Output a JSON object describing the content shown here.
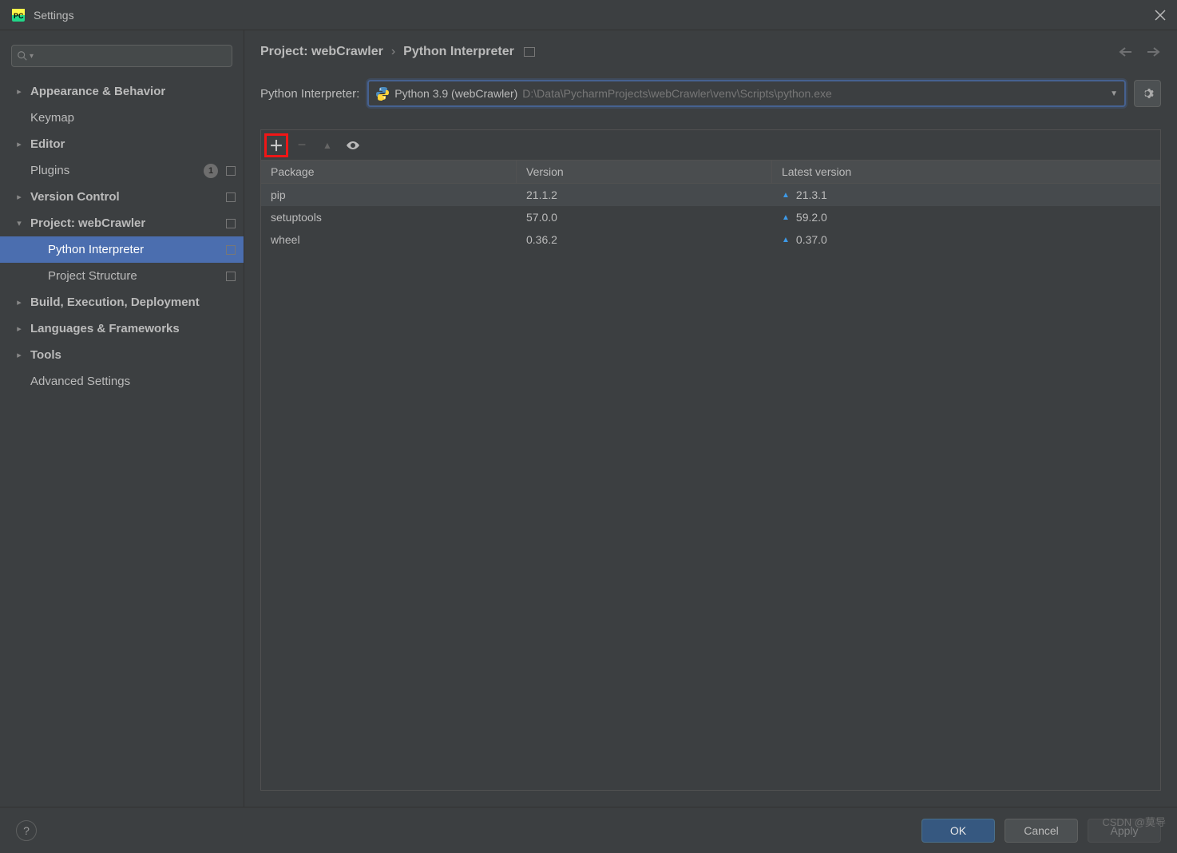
{
  "window": {
    "title": "Settings"
  },
  "sidebar": {
    "search_placeholder": "",
    "items": [
      {
        "label": "Appearance & Behavior",
        "expandable": true,
        "expanded": false
      },
      {
        "label": "Keymap",
        "expandable": false
      },
      {
        "label": "Editor",
        "expandable": true,
        "expanded": false
      },
      {
        "label": "Plugins",
        "expandable": false,
        "badge": "1",
        "square": true
      },
      {
        "label": "Version Control",
        "expandable": true,
        "expanded": false,
        "square": true
      },
      {
        "label": "Project: webCrawler",
        "expandable": true,
        "expanded": true,
        "square": true,
        "children": [
          {
            "label": "Python Interpreter",
            "selected": true,
            "square": true
          },
          {
            "label": "Project Structure",
            "square": true
          }
        ]
      },
      {
        "label": "Build, Execution, Deployment",
        "expandable": true,
        "expanded": false
      },
      {
        "label": "Languages & Frameworks",
        "expandable": true,
        "expanded": false
      },
      {
        "label": "Tools",
        "expandable": true,
        "expanded": false
      },
      {
        "label": "Advanced Settings",
        "expandable": false
      }
    ]
  },
  "breadcrumb": {
    "project": "Project: webCrawler",
    "page": "Python Interpreter"
  },
  "interpreter": {
    "label": "Python Interpreter:",
    "name": "Python 3.9 (webCrawler)",
    "path": "D:\\Data\\PycharmProjects\\webCrawler\\venv\\Scripts\\python.exe"
  },
  "packages": {
    "columns": {
      "package": "Package",
      "version": "Version",
      "latest": "Latest version"
    },
    "rows": [
      {
        "name": "pip",
        "version": "21.1.2",
        "latest": "21.3.1",
        "upgrade": true
      },
      {
        "name": "setuptools",
        "version": "57.0.0",
        "latest": "59.2.0",
        "upgrade": true
      },
      {
        "name": "wheel",
        "version": "0.36.2",
        "latest": "0.37.0",
        "upgrade": true
      }
    ]
  },
  "buttons": {
    "ok": "OK",
    "cancel": "Cancel",
    "apply": "Apply"
  },
  "watermark": "CSDN @莫导"
}
